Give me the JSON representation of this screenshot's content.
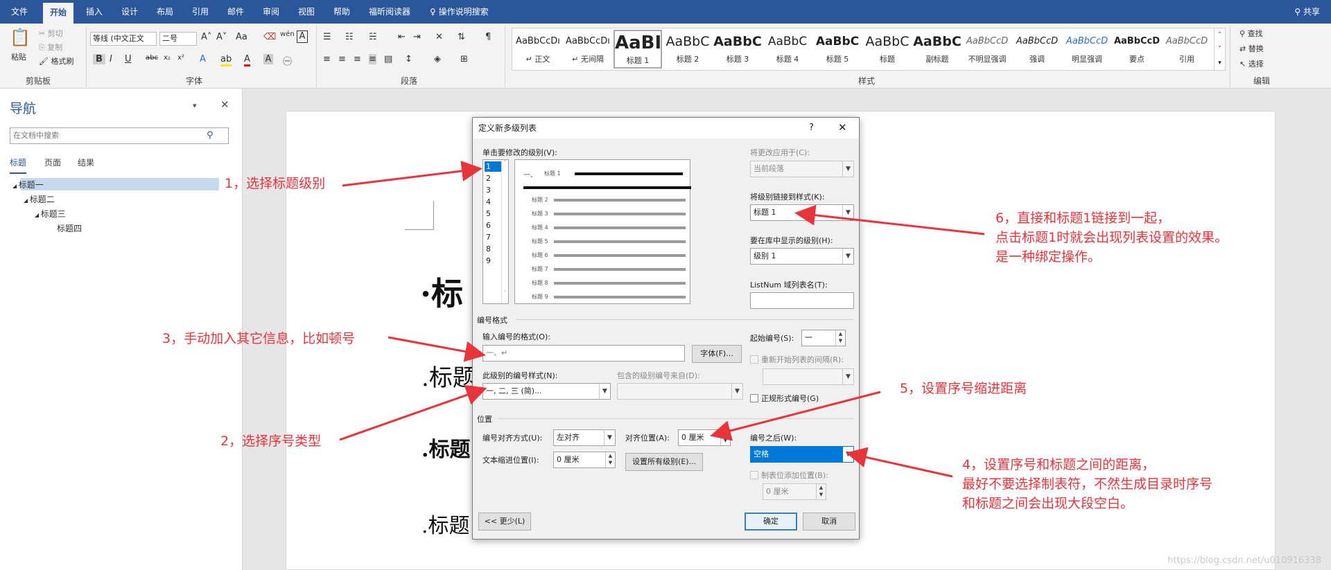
{
  "ribbon": {
    "tabs": [
      "文件",
      "开始",
      "插入",
      "设计",
      "布局",
      "引用",
      "邮件",
      "审阅",
      "视图",
      "帮助",
      "福昕阅读器",
      "操作说明搜索"
    ],
    "share": "共享",
    "clipboard": {
      "paste": "粘贴",
      "cut": "剪切",
      "copy": "复制",
      "format_painter": "格式刷",
      "group": "剪贴板"
    },
    "font": {
      "name": "等线 (中文正文",
      "size": "二号",
      "group": "字体"
    },
    "paragraph": {
      "group": "段落"
    },
    "styles": {
      "group": "样式",
      "items": [
        {
          "sample": "AaBbCcDı",
          "name": "↵ 正文"
        },
        {
          "sample": "AaBbCcDı",
          "name": "↵ 无间隔"
        },
        {
          "sample": "AaBI",
          "name": "标题 1"
        },
        {
          "sample": "AaBbC",
          "name": "标题 2"
        },
        {
          "sample": "AaBbC",
          "name": "标题 3"
        },
        {
          "sample": "AaBbC",
          "name": "标题 4"
        },
        {
          "sample": "AaBbC",
          "name": "标题 5"
        },
        {
          "sample": "AaBbC",
          "name": "标题"
        },
        {
          "sample": "AaBbC",
          "name": "副标题"
        },
        {
          "sample": "AaBbCcD",
          "name": "不明显强调"
        },
        {
          "sample": "AaBbCcD",
          "name": "强调"
        },
        {
          "sample": "AaBbCcD",
          "name": "明显强调"
        },
        {
          "sample": "AaBbCcD",
          "name": "要点"
        },
        {
          "sample": "AaBbCcD",
          "name": "引用"
        }
      ]
    },
    "editing": {
      "find": "查找",
      "replace": "替换",
      "select": "选择",
      "group": "编辑"
    }
  },
  "nav": {
    "title": "导航",
    "search_placeholder": "在文档中搜索",
    "tabs": [
      "标题",
      "页面",
      "结果"
    ],
    "tree": [
      "标题一",
      "标题二",
      "标题三",
      "标题四"
    ]
  },
  "document": {
    "headings": [
      "标",
      "标题",
      "标题",
      "标题"
    ]
  },
  "dialog": {
    "title": "定义新多级列表",
    "help": "?",
    "click_level_label": "单击要修改的级别(V):",
    "levels": [
      "1",
      "2",
      "3",
      "4",
      "5",
      "6",
      "7",
      "8",
      "9"
    ],
    "preview": {
      "first": "一、",
      "labels": [
        "标题 1",
        "标题 2",
        "标题 3",
        "标题 4",
        "标题 5",
        "标题 6",
        "标题 7",
        "标题 8",
        "标题 9"
      ]
    },
    "apply_to_label": "将更改应用于(C):",
    "apply_to_value": "当前段落",
    "link_style_label": "将级别链接到样式(K):",
    "link_style_value": "标题 1",
    "gallery_level_label": "要在库中显示的级别(H):",
    "gallery_level_value": "级别 1",
    "listnum_label": "ListNum 域列表名(T):",
    "listnum_value": "",
    "number_format_section": "编号格式",
    "enter_format_label": "输入编号的格式(O):",
    "enter_format_value": "一、↵",
    "font_button": "字体(F)...",
    "start_at_label": "起始编号(S):",
    "start_at_value": "一",
    "restart_label": "重新开始列表的间隔(R):",
    "number_style_label": "此级别的编号样式(N):",
    "number_style_value": "一, 二, 三 (简)...",
    "include_level_label": "包含的级别编号来自(D):",
    "include_level_value": "",
    "legal_label": "正规形式编号(G)",
    "position_section": "位置",
    "alignment_label": "编号对齐方式(U):",
    "alignment_value": "左对齐",
    "aligned_at_label": "对齐位置(A):",
    "aligned_at_value": "0 厘米",
    "text_indent_label": "文本缩进位置(I):",
    "text_indent_value": "0 厘米",
    "set_all_button": "设置所有级别(E)...",
    "follow_label": "编号之后(W):",
    "follow_value": "空格",
    "tab_stop_label": "制表位添加位置(B):",
    "tab_stop_value": "0 厘米",
    "less_button": "<< 更少(L)",
    "ok_button": "确定",
    "cancel_button": "取消"
  },
  "annotations": {
    "a1": "1，选择标题级别",
    "a2": "2，选择序号类型",
    "a3": "3，手动加入其它信息，比如顿号",
    "a4_line1": "4，设置序号和标题之间的距离，",
    "a4_line2": "最好不要选择制表符，不然生成目录时序号",
    "a4_line3": "和标题之间会出现大段空白。",
    "a5": "5，设置序号缩进距离",
    "a6_line1": "6，直接和标题1链接到一起，",
    "a6_line2": "点击标题1时就会出现列表设置的效果。",
    "a6_line3": "是一种绑定操作。"
  },
  "watermark": "https://blog.csdn.net/u010916338",
  "colors": {
    "ribbon": "#2b579a",
    "annotation": "#e8343a",
    "selection": "#0078d7"
  }
}
